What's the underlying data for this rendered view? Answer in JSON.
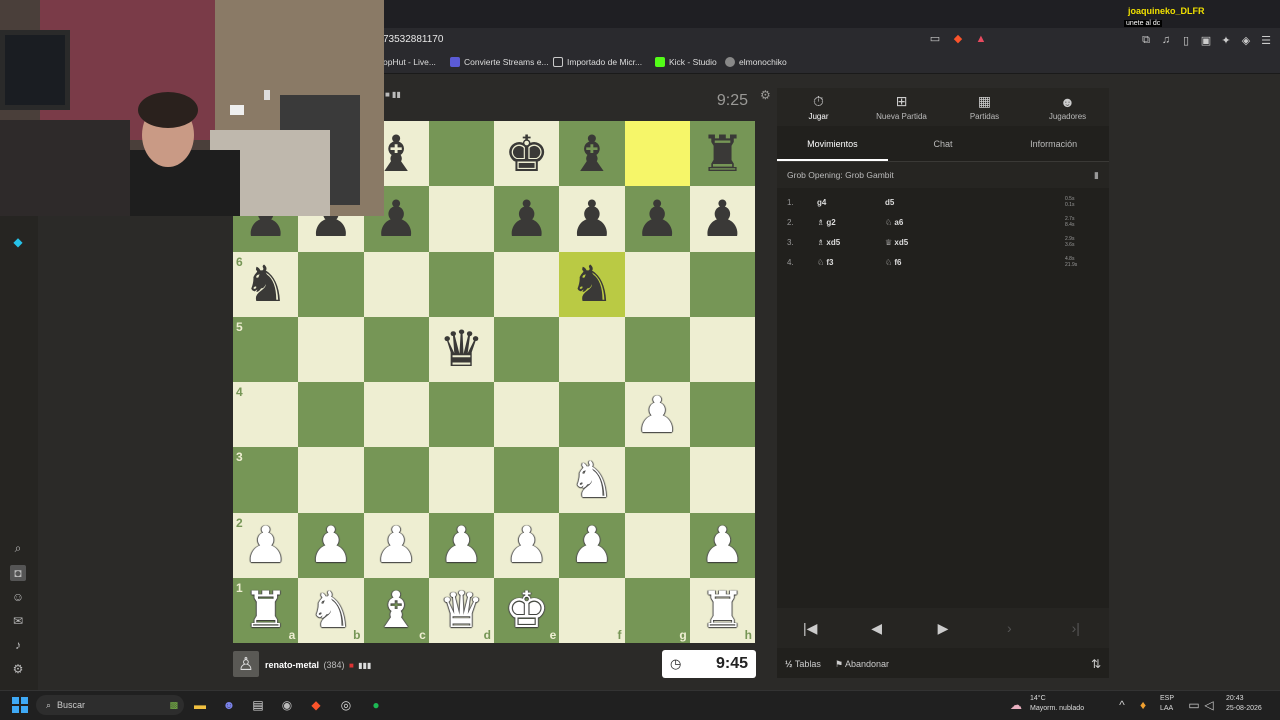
{
  "browser": {
    "url_fragment": "73532881170",
    "bookmarks": [
      {
        "label": "opHut - Live...",
        "color": "#d9d9d9"
      },
      {
        "label": "Convierte Streams e...",
        "color": "#5b5bd6"
      },
      {
        "label": "Importado de Micr...",
        "color": "#c9c9c9"
      },
      {
        "label": "Kick - Studio",
        "color": "#53fc18"
      },
      {
        "label": "elmonochiko",
        "color": "#aaaaaa"
      }
    ],
    "sponsor_name": "joaquineko_DLFR",
    "sponsor_sub": "unete al dc"
  },
  "game": {
    "top_clock": "9:25",
    "bottom_clock": "9:45",
    "bottom_player": {
      "name": "renato-metal",
      "rating": "(384)"
    },
    "board": [
      [
        "",
        "",
        "bB",
        "",
        "bK",
        "bB",
        "",
        "bR"
      ],
      [
        "bP",
        "bP",
        "bP",
        "",
        "bP",
        "bP",
        "bP",
        "bP"
      ],
      [
        "bN",
        "",
        "",
        "",
        "",
        "bN",
        "",
        ""
      ],
      [
        "",
        "",
        "",
        "bQ",
        "",
        "",
        "",
        ""
      ],
      [
        "",
        "",
        "",
        "",
        "",
        "",
        "wP",
        ""
      ],
      [
        "",
        "",
        "",
        "",
        "",
        "wN",
        "",
        ""
      ],
      [
        "wP",
        "wP",
        "wP",
        "wP",
        "wP",
        "wP",
        "",
        "wP"
      ],
      [
        "wR",
        "wN",
        "wB",
        "wQ",
        "wK",
        "",
        "",
        "wR"
      ]
    ],
    "highlights": [
      "g8",
      "f6"
    ],
    "rank_labels": [
      "6",
      "5",
      "4",
      "3",
      "2",
      "1"
    ],
    "file_labels": [
      "a",
      "b",
      "c",
      "d",
      "e",
      "f",
      "g",
      "h"
    ]
  },
  "panel": {
    "tabs": [
      {
        "label": "Jugar",
        "icon": "stopwatch-icon"
      },
      {
        "label": "Nueva Partida",
        "icon": "plus-icon"
      },
      {
        "label": "Partidas",
        "icon": "board-icon"
      },
      {
        "label": "Jugadores",
        "icon": "players-icon"
      }
    ],
    "subtabs": [
      "Movimientos",
      "Chat",
      "Información"
    ],
    "opening": "Grob Opening: Grob Gambit",
    "moves": [
      {
        "n": "1.",
        "w": "g4",
        "b": "d5",
        "t1": "0.5s",
        "t2": "0.1s"
      },
      {
        "n": "2.",
        "w": "♗ g2",
        "b": "♘ a6",
        "t1": "2.7s",
        "t2": "8.4s"
      },
      {
        "n": "3.",
        "w": "♗ xd5",
        "b": "♕ xd5",
        "t1": "2.9s",
        "t2": "3.6s"
      },
      {
        "n": "4.",
        "w": "♘ f3",
        "b": "♘ f6",
        "t1": "4.8s",
        "t2": "21.9s"
      }
    ],
    "draw_label": "Tablas",
    "draw_prefix": "½",
    "resign_label": "Abandonar"
  },
  "taskbar": {
    "search_label": "Buscar",
    "weather_temp": "14°C",
    "weather_desc": "Mayorm. nublado",
    "lang1": "ESP",
    "lang2": "LAA",
    "time": "20:43",
    "date": "25-08-2026"
  }
}
